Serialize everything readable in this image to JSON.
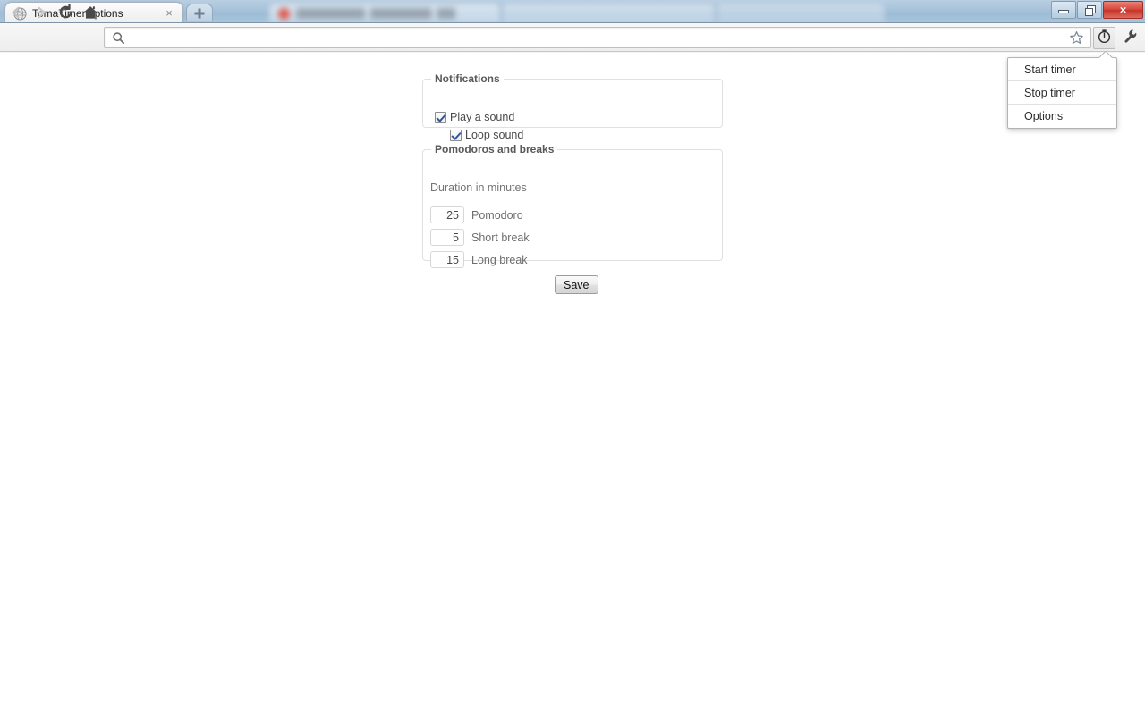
{
  "browser": {
    "tabs": [
      {
        "title": "TomaTimer options",
        "favicon": "globe-icon",
        "active": true
      },
      {
        "title": "",
        "favicon": "red-circle-icon",
        "active": false
      },
      {
        "title": "",
        "favicon": "",
        "active": false
      },
      {
        "title": "",
        "favicon": "",
        "active": false
      }
    ],
    "new_tab_label": "+",
    "tab_close_label": "×",
    "nav": {
      "back": "back-arrow",
      "forward": "forward-arrow",
      "reload": "reload-icon",
      "home": "home-icon"
    },
    "omnibox": {
      "value": "",
      "placeholder": "",
      "search_icon": "search-icon",
      "star_icon": "star-icon"
    },
    "extension_button": "timer-icon",
    "menu_button": "wrench-icon",
    "window_controls": {
      "minimize": "–",
      "maximize": "❐",
      "close": "×"
    }
  },
  "extension_menu": {
    "items": [
      {
        "label": "Start timer"
      },
      {
        "label": "Stop timer"
      },
      {
        "label": "Options"
      }
    ]
  },
  "options_page": {
    "notifications": {
      "legend": "Notifications",
      "checkboxes": [
        {
          "label": "Play a sound",
          "checked": true
        },
        {
          "label": "Loop sound",
          "checked": true
        }
      ]
    },
    "pomodoros": {
      "legend": "Pomodoros and breaks",
      "duration_label": "Duration in minutes",
      "fields": [
        {
          "label": "Pomodoro",
          "value": "25"
        },
        {
          "label": "Short break",
          "value": "5"
        },
        {
          "label": "Long break",
          "value": "15"
        }
      ]
    },
    "save_label": "Save"
  },
  "colors": {
    "frame": "#a9c4db",
    "toolbar": "#f1f1f1",
    "legend_text": "#59595b",
    "body_text": "#4a4a4a",
    "close_button": "#d8453a",
    "checkmark": "#32549a"
  }
}
